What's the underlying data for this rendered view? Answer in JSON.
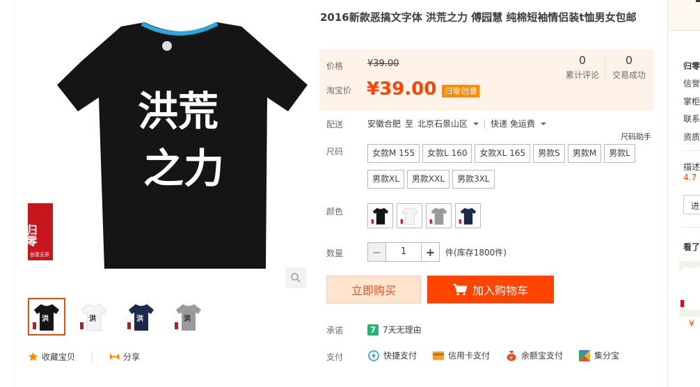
{
  "product": {
    "title": "2016新款恶搞文字体 洪荒之力 傅园慧 纯棉短袖情侣装t恤男女包邮",
    "shirt_text_line1": "洪荒",
    "shirt_text_line2": "之力",
    "brand_logo": "归零",
    "brand_sub": "创意无界"
  },
  "price": {
    "label_price": "价格",
    "original": "¥39.00",
    "label_taobao": "淘宝价",
    "current": "¥39.00",
    "tag": "归零创意",
    "reviews_count": "0",
    "reviews_label": "累计评论",
    "deals_count": "0",
    "deals_label": "交易成功"
  },
  "shipping": {
    "label": "配送",
    "from": "安徽合肥",
    "to_word": "至",
    "to": "北京石景山区",
    "method": "快递 免运费"
  },
  "size": {
    "label": "尺码",
    "helper": "尺码助手",
    "options": [
      "女款M 155",
      "女款L 160",
      "女款XL 165",
      "男款S",
      "男款M",
      "男款L",
      "男款XL",
      "男款XXL",
      "男款3XL"
    ]
  },
  "color": {
    "label": "颜色",
    "swatches": [
      "#151515",
      "#f4f4f4",
      "#9a9a9a",
      "#1b2a4a"
    ]
  },
  "quantity": {
    "label": "数量",
    "value": "1",
    "minus": "−",
    "plus": "+",
    "stock": "件(库存1800件)"
  },
  "buttons": {
    "buy_now": "立即购买",
    "add_cart": "加入购物车"
  },
  "promise": {
    "label": "承诺",
    "badge": "7",
    "text": "7天无理由"
  },
  "payment": {
    "label": "支付",
    "methods": [
      "快捷支付",
      "信用卡支付",
      "余额宝支付",
      "集分宝"
    ]
  },
  "gallery": {
    "thumb_colors": [
      "#151515",
      "#f4f4f4",
      "#1b2a4a",
      "#9a9a9a"
    ],
    "favorite": "收藏宝贝",
    "share": "分享"
  },
  "sidebar": {
    "shop_name": "归零",
    "rows": [
      "信誉",
      "掌柜",
      "联系",
      "资质"
    ],
    "rating_label": "描述",
    "rating_value": "4.7",
    "enter_button": "进",
    "also_viewed": "看了",
    "thumb_price": "¥"
  },
  "colors": {
    "accent": "#ff4400",
    "price_bg": "#fff2e8",
    "buy_now_bg": "#ffe4d0"
  }
}
